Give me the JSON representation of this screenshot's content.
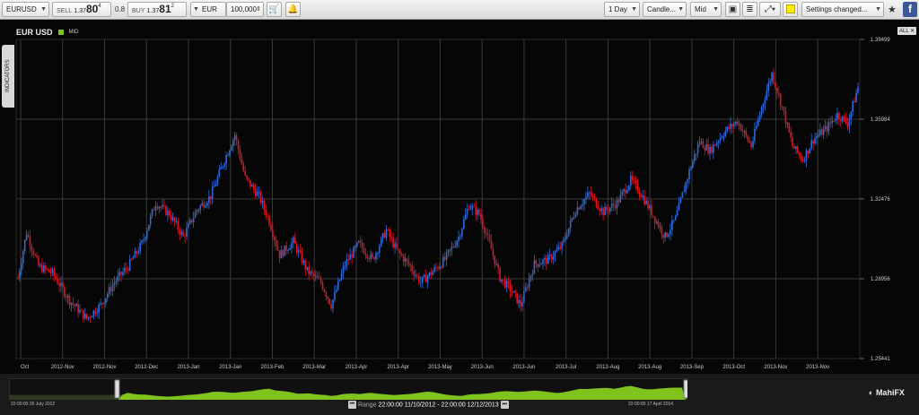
{
  "toolbar": {
    "symbol": "EURUSD",
    "sell_label": "SELL",
    "sell_price_prefix": "1.37",
    "sell_price_big": "80",
    "sell_price_sup": "4",
    "spread": "0.8",
    "buy_label": "BUY",
    "buy_price_prefix": "1.37",
    "buy_price_big": "81",
    "buy_price_sup": "2",
    "currency": "EUR",
    "amount": "100,000",
    "interval": "1 Day",
    "chart_type": "Candle...",
    "price_type": "Mid",
    "settings": "Settings changed...",
    "fb_letter": "f"
  },
  "chart": {
    "title": "EUR USD",
    "mid_label": "MID",
    "all_label": "ALL",
    "indicators_label": "INDICATORS"
  },
  "navigator": {
    "start_label": "22:00:00 26 July 2012",
    "end_label": "22:00:00 17 April 2014",
    "range_label": "Range",
    "range_value": "22:00:00 11/10/2012 - 22:00:00 12/12/2013",
    "brand": "MahiFX"
  },
  "colors": {
    "bull": "#2f6bd8",
    "bear": "#e0141e",
    "grid": "#3a3a3a",
    "accent_green": "#7fc31c"
  },
  "chart_data": {
    "type": "candlestick",
    "title": "EUR USD",
    "yaxis_ticks": [
      "1.39499",
      "1.35984",
      "1.32476",
      "1.28956",
      "1.25441"
    ],
    "ylim": [
      1.25441,
      1.39499
    ],
    "xaxis_ticks": [
      "Oct",
      "2012-Nov",
      "2012-Nov",
      "2012-Dec",
      "2013-Jan",
      "2013-Jan",
      "2013-Feb",
      "2013-Mar",
      "2013-Apr",
      "2013-Apr",
      "2013-May",
      "2013-Jun",
      "2013-Jun",
      "2013-Jul",
      "2013-Aug",
      "2013-Aug",
      "2013-Sep",
      "2013-Oct",
      "2013-Nov",
      "2013-Nov"
    ],
    "close_path": [
      [
        0,
        1.29
      ],
      [
        5,
        1.31
      ],
      [
        12,
        1.295
      ],
      [
        20,
        1.292
      ],
      [
        30,
        1.28
      ],
      [
        40,
        1.272
      ],
      [
        48,
        1.278
      ],
      [
        56,
        1.288
      ],
      [
        64,
        1.295
      ],
      [
        72,
        1.305
      ],
      [
        80,
        1.323
      ],
      [
        88,
        1.318
      ],
      [
        96,
        1.308
      ],
      [
        104,
        1.32
      ],
      [
        112,
        1.326
      ],
      [
        120,
        1.342
      ],
      [
        126,
        1.353
      ],
      [
        132,
        1.334
      ],
      [
        140,
        1.326
      ],
      [
        146,
        1.315
      ],
      [
        152,
        1.3
      ],
      [
        160,
        1.306
      ],
      [
        168,
        1.293
      ],
      [
        176,
        1.288
      ],
      [
        182,
        1.278
      ],
      [
        190,
        1.296
      ],
      [
        198,
        1.305
      ],
      [
        206,
        1.298
      ],
      [
        214,
        1.311
      ],
      [
        220,
        1.302
      ],
      [
        228,
        1.295
      ],
      [
        234,
        1.288
      ],
      [
        240,
        1.292
      ],
      [
        248,
        1.298
      ],
      [
        256,
        1.308
      ],
      [
        262,
        1.322
      ],
      [
        268,
        1.318
      ],
      [
        274,
        1.305
      ],
      [
        280,
        1.29
      ],
      [
        286,
        1.285
      ],
      [
        292,
        1.278
      ],
      [
        300,
        1.296
      ],
      [
        308,
        1.298
      ],
      [
        316,
        1.304
      ],
      [
        324,
        1.32
      ],
      [
        332,
        1.327
      ],
      [
        340,
        1.319
      ],
      [
        348,
        1.323
      ],
      [
        356,
        1.333
      ],
      [
        362,
        1.327
      ],
      [
        370,
        1.316
      ],
      [
        376,
        1.308
      ],
      [
        382,
        1.316
      ],
      [
        390,
        1.337
      ],
      [
        396,
        1.35
      ],
      [
        402,
        1.346
      ],
      [
        410,
        1.354
      ],
      [
        418,
        1.359
      ],
      [
        426,
        1.348
      ],
      [
        432,
        1.365
      ],
      [
        438,
        1.38
      ],
      [
        444,
        1.365
      ],
      [
        450,
        1.348
      ],
      [
        456,
        1.342
      ],
      [
        462,
        1.351
      ],
      [
        470,
        1.356
      ],
      [
        476,
        1.362
      ],
      [
        482,
        1.358
      ],
      [
        488,
        1.374
      ]
    ]
  }
}
